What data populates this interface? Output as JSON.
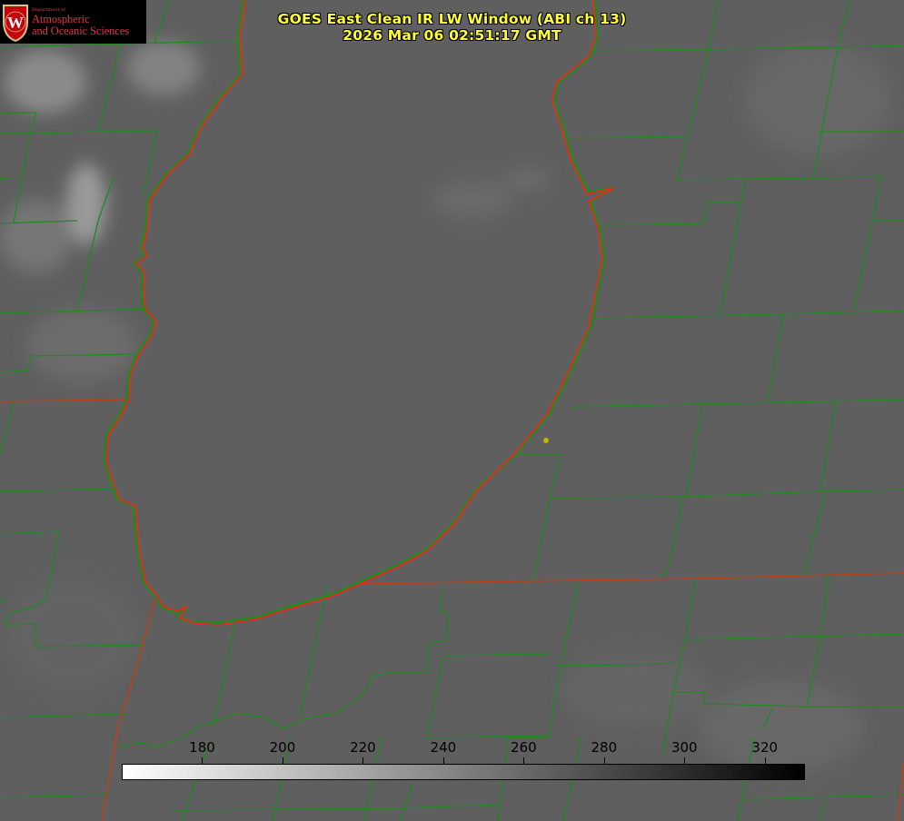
{
  "title": {
    "line1": "GOES East Clean IR LW Window (ABI ch 13)",
    "line2": "2026 Mar 06 02:51:17 GMT"
  },
  "logo": {
    "department": "Department of",
    "line1": "Atmospheric",
    "line2": "and Oceanic Sciences",
    "seal_letter": "W"
  },
  "colorbar": {
    "unit_range": [
      160,
      330
    ],
    "ticks": [
      "180",
      "200",
      "220",
      "240",
      "260",
      "280",
      "300",
      "320"
    ],
    "gradient_from": "#ffffff",
    "gradient_to": "#000000"
  },
  "map": {
    "background": "#5f5f5f",
    "county_line_color": "#1f8a1f",
    "lake_outline_color": "#ff2020",
    "state_line_color": "#c0401a",
    "marker_color": "#c8b400",
    "marker_icon": "station-dot-icon"
  }
}
